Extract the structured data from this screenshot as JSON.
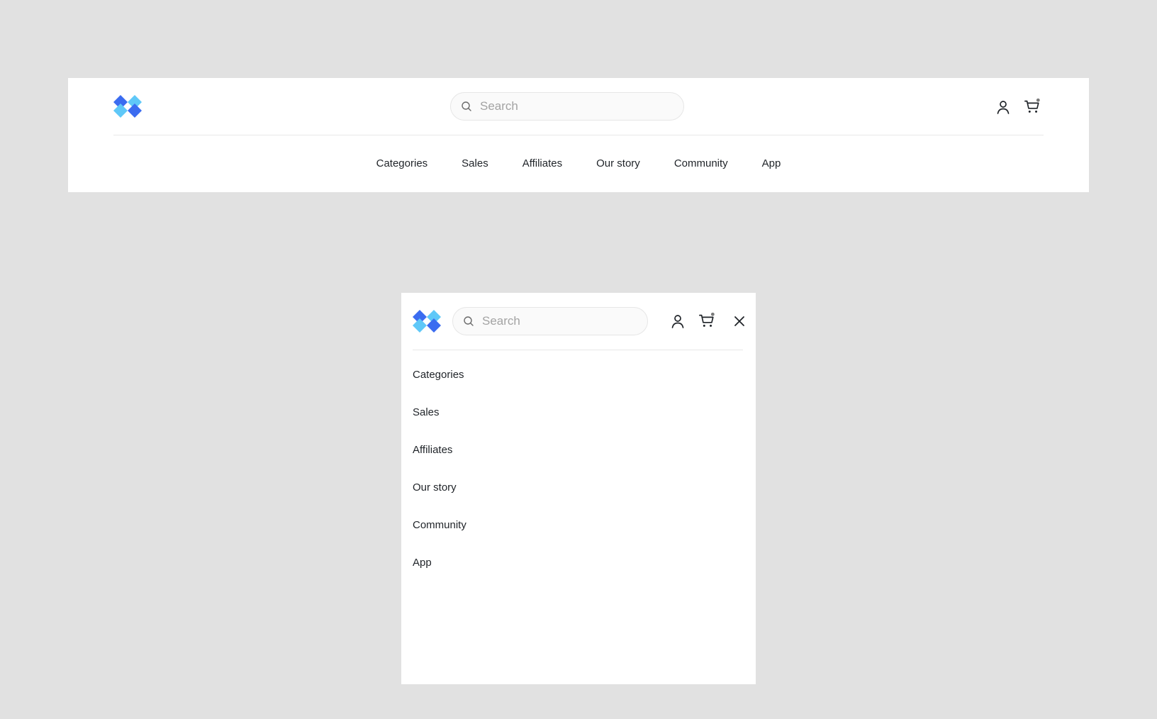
{
  "brand": {
    "logo_icon": "diamond-logo-icon",
    "colors": {
      "light": "#5fc8f8",
      "dark": "#3b6cf0"
    }
  },
  "desktop": {
    "search": {
      "placeholder": "Search",
      "value": ""
    },
    "nav": {
      "items": [
        "Categories",
        "Sales",
        "Affiliates",
        "Our story",
        "Community",
        "App"
      ]
    }
  },
  "mobile": {
    "search": {
      "placeholder": "Search",
      "value": ""
    },
    "nav": {
      "items": [
        "Categories",
        "Sales",
        "Affiliates",
        "Our story",
        "Community",
        "App"
      ]
    }
  },
  "icons": {
    "search": "search-icon",
    "user": "user-icon",
    "cart": "cart-icon",
    "close": "close-icon"
  },
  "colors": {
    "page_background": "#e1e1e1",
    "card_background": "#ffffff",
    "text": "#1f2328",
    "placeholder": "#a3a3a3",
    "cart_badge": "#7a7a7a"
  }
}
